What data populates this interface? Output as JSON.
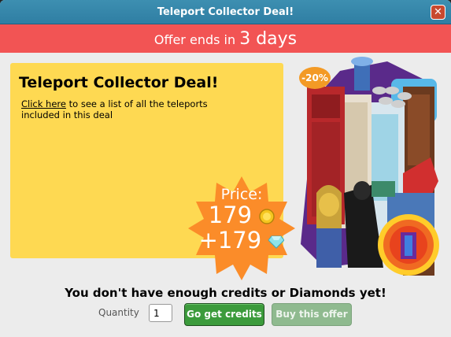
{
  "window": {
    "title": "Teleport Collector Deal!",
    "close_label": "✕"
  },
  "banner": {
    "prefix": "Offer ends in",
    "highlight": "3 days"
  },
  "promo": {
    "title": "Teleport Collector Deal!",
    "link_text": "Click here",
    "description": " to see a list of all the teleports included in this deal"
  },
  "price": {
    "label": "Price:",
    "credits": "179",
    "diamonds": "+179"
  },
  "discount": "-20%",
  "warning": "You don't have enough credits or Diamonds yet!",
  "purchase": {
    "quantity_label": "Quantity",
    "quantity_value": "1",
    "get_credits_label": "Go get credits",
    "buy_label": "Buy this offer"
  },
  "colors": {
    "titlebar": "#3a8ab0",
    "banner": "#f25454",
    "promo": "#fed952",
    "burst": "#fb8c29",
    "button": "#3c9b3c"
  },
  "icons": [
    "close-icon",
    "credit-coin-icon",
    "diamond-icon",
    "price-burst-icon",
    "discount-badge-icon"
  ]
}
